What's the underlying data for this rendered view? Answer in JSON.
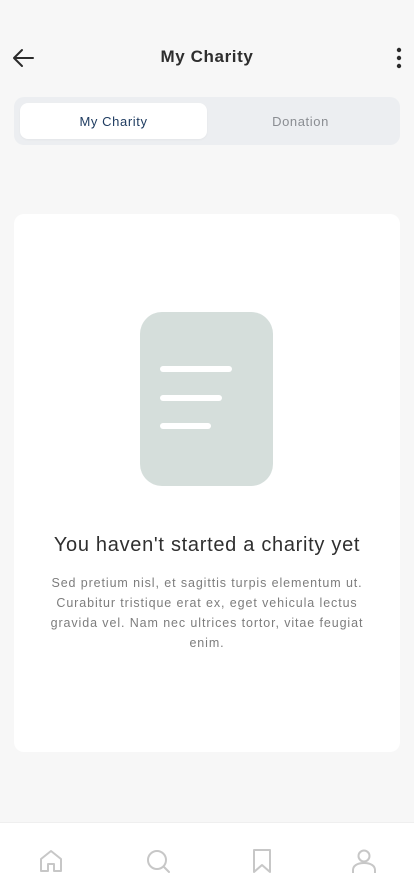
{
  "header": {
    "title": "My Charity",
    "back_icon": "arrow-left-icon",
    "more_icon": "more-vertical-icon"
  },
  "tabs": [
    {
      "label": "My Charity",
      "active": true
    },
    {
      "label": "Donation",
      "active": false
    }
  ],
  "empty_state": {
    "illustration_icon": "document-icon",
    "title": "You haven't started a charity yet",
    "description": "Sed pretium nisl, et sagittis turpis elementum ut. Curabitur tristique erat ex, eget vehicula lectus gravida vel. Nam nec ultrices tortor, vitae feugiat enim."
  },
  "bottom_nav": [
    {
      "name": "home",
      "icon": "home-icon"
    },
    {
      "name": "search",
      "icon": "search-icon"
    },
    {
      "name": "bookmark",
      "icon": "bookmark-icon"
    },
    {
      "name": "profile",
      "icon": "user-icon"
    }
  ],
  "colors": {
    "background": "#f7f7f7",
    "active_tab_text": "#1d3a5f",
    "illustration": "#d5dedb",
    "nav_icon": "#c7c7c7"
  }
}
